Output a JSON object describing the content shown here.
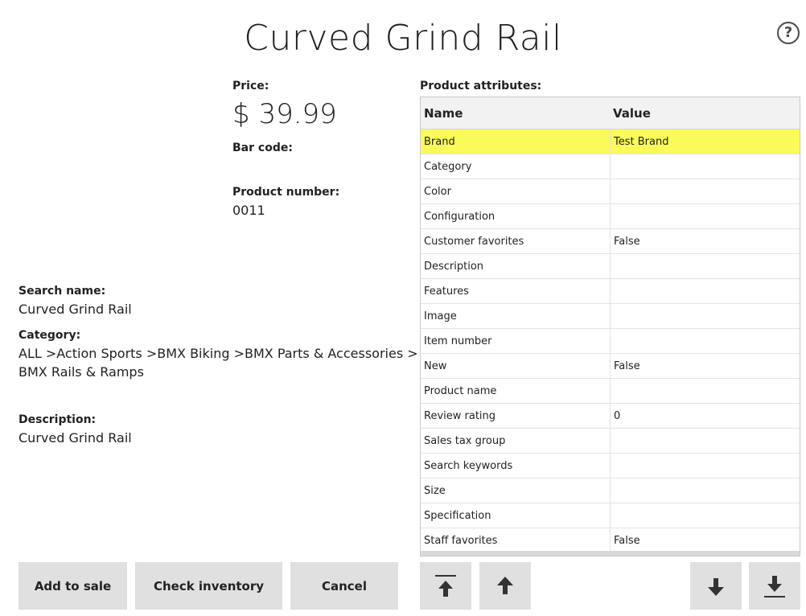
{
  "header": {
    "title": "Curved Grind Rail",
    "help_icon": "?"
  },
  "details": {
    "price_label": "Price:",
    "price_value": "$ 39.99",
    "barcode_label": "Bar code:",
    "product_number_label": "Product number:",
    "product_number_value": "0011",
    "search_name_label": "Search name:",
    "search_name_value": "Curved Grind Rail",
    "category_label": "Category:",
    "category_line1": "ALL >Action Sports >BMX Biking >BMX Parts & Accessories >",
    "category_line2": "BMX Rails & Ramps",
    "description_label": "Description:",
    "description_value": "Curved Grind Rail"
  },
  "attributes": {
    "section_label": "Product attributes:",
    "col_name": "Name",
    "col_value": "Value",
    "rows": [
      {
        "name": "Brand",
        "value": "Test Brand",
        "selected": true
      },
      {
        "name": "Category",
        "value": ""
      },
      {
        "name": "Color",
        "value": ""
      },
      {
        "name": "Configuration",
        "value": ""
      },
      {
        "name": "Customer favorites",
        "value": "False"
      },
      {
        "name": "Description",
        "value": ""
      },
      {
        "name": "Features",
        "value": ""
      },
      {
        "name": "Image",
        "value": ""
      },
      {
        "name": "Item number",
        "value": ""
      },
      {
        "name": "New",
        "value": "False"
      },
      {
        "name": "Product name",
        "value": ""
      },
      {
        "name": "Review rating",
        "value": "0"
      },
      {
        "name": "Sales tax group",
        "value": ""
      },
      {
        "name": "Search keywords",
        "value": ""
      },
      {
        "name": "Size",
        "value": ""
      },
      {
        "name": "Specification",
        "value": ""
      },
      {
        "name": "Staff favorites",
        "value": "False"
      }
    ]
  },
  "actions": {
    "add_to_sale": "Add to sale",
    "check_inventory": "Check inventory",
    "cancel": "Cancel"
  },
  "navigation": {
    "first_icon": "arrow-to-top-icon",
    "up_icon": "arrow-up-icon",
    "down_icon": "arrow-down-icon",
    "last_icon": "arrow-to-bottom-icon"
  },
  "colors": {
    "highlight": "#fafa5a",
    "button_bg": "#e0e0e0"
  }
}
